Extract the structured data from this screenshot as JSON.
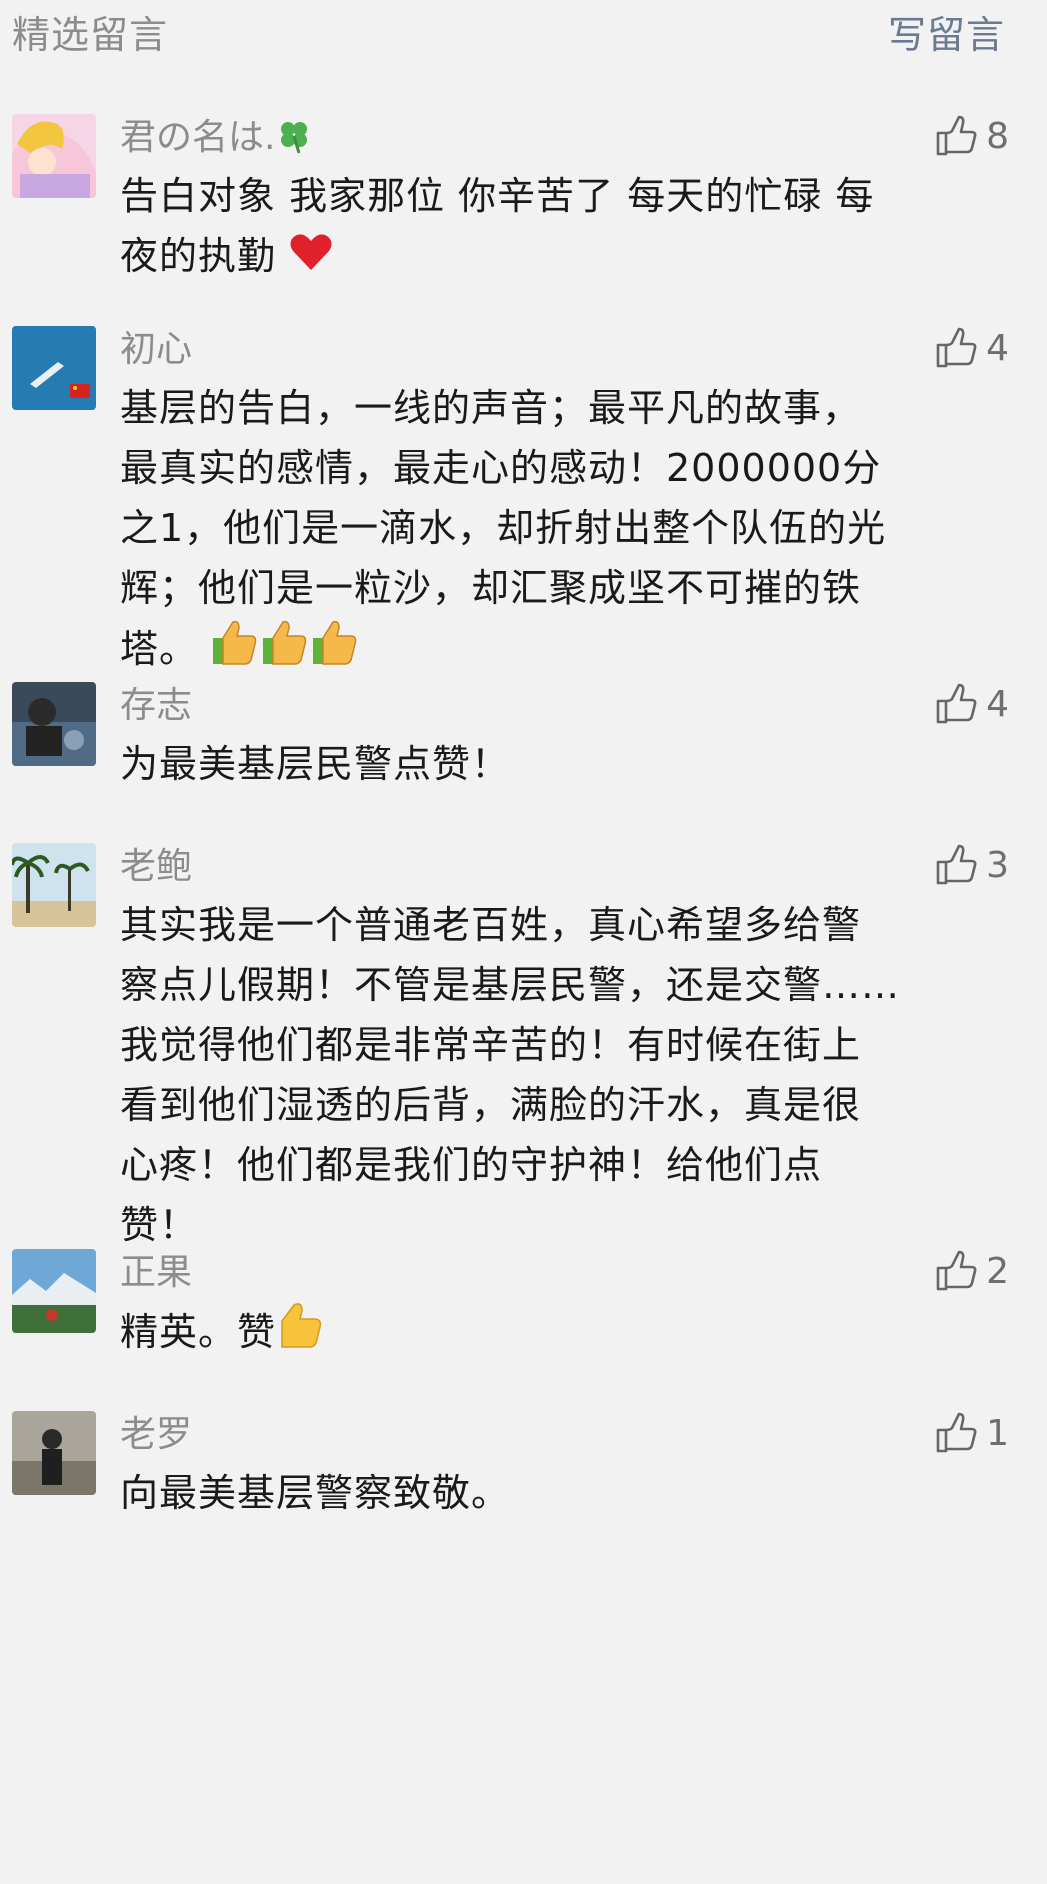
{
  "header": {
    "title": "精选留言",
    "write_label": "写留言"
  },
  "comments": [
    {
      "nickname": "君の名は.",
      "nick_emoji": "clover-icon",
      "likes": "8",
      "text": "告白对象 我家那位 你辛苦了 每天的忙碌 每\n夜的执勤",
      "emoji": "heart-icon"
    },
    {
      "nickname": "初心",
      "likes": "4",
      "text": "基层的告白，一线的声音；最平凡的故事，\n最真实的感情，最走心的感动！2000000分\n之1，他们是一滴水，却折射出整个队伍的光\n辉；他们是一粒沙，却汇聚成坚不可摧的铁\n塔。",
      "emoji": "thumbs-up-icon x3"
    },
    {
      "nickname": "存志",
      "likes": "4",
      "text": "为最美基层民警点赞！"
    },
    {
      "nickname": "老鲍",
      "likes": "3",
      "text": "其实我是一个普通老百姓，真心希望多给警\n察点儿假期！不管是基层民警，还是交警……\n我觉得他们都是非常辛苦的！有时候在街上\n看到他们湿透的后背，满脸的汗水，真是很\n心疼！他们都是我们的守护神！给他们点\n赞！"
    },
    {
      "nickname": "正果",
      "likes": "2",
      "text": "精英。赞",
      "emoji": "thumbs-up-icon"
    },
    {
      "nickname": "老罗",
      "likes": "1",
      "text": "向最美基层警察致敬。"
    }
  ],
  "colors": {
    "background": "#f2f2f2",
    "nickname": "#8c8c8c",
    "link": "#6b7a91",
    "text": "#1a1a1a"
  }
}
